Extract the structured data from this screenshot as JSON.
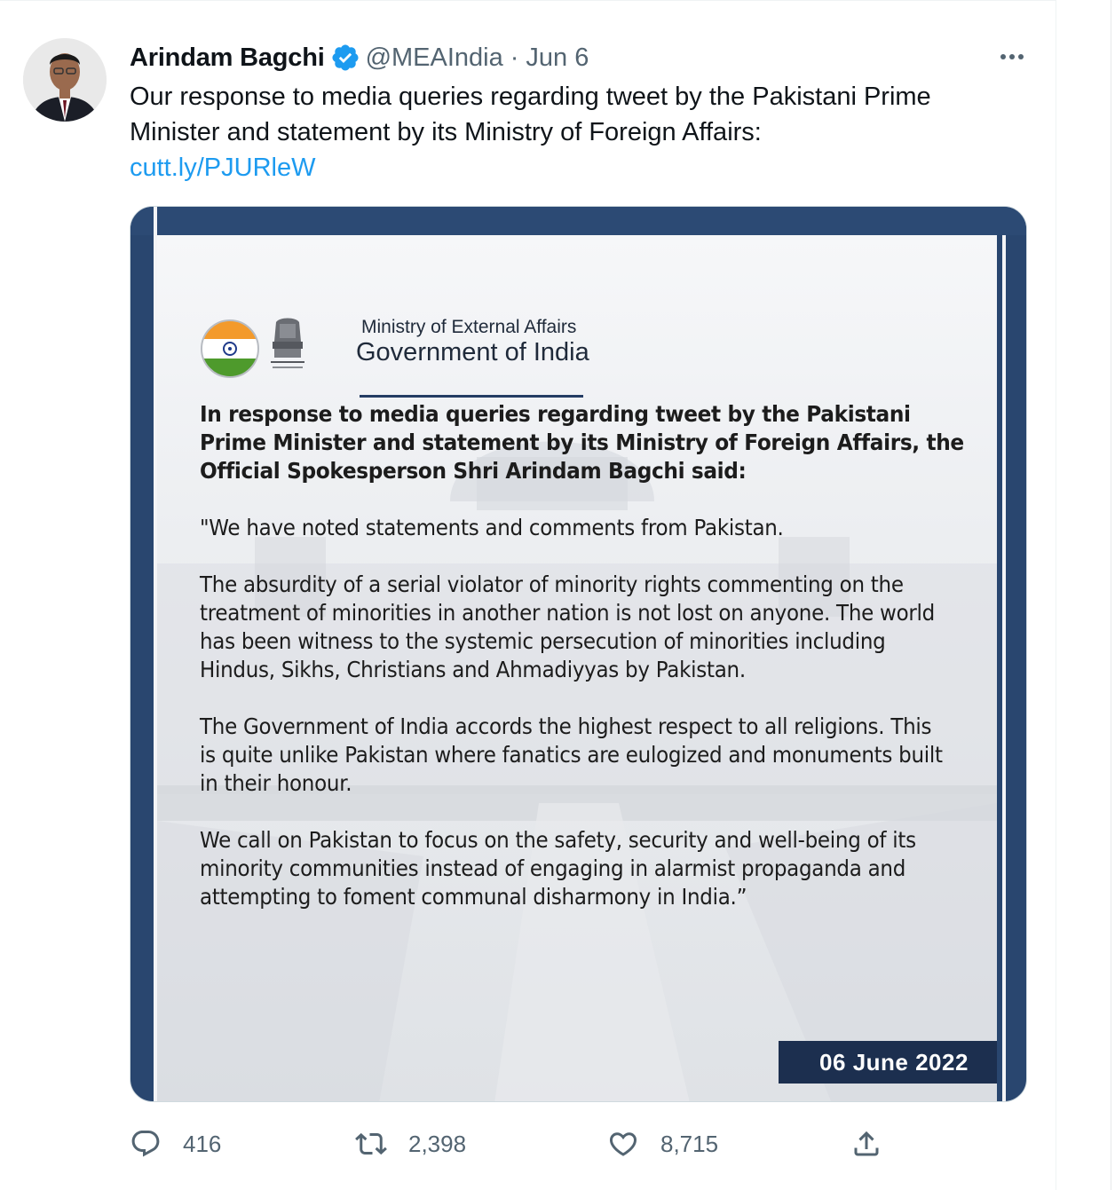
{
  "tweet": {
    "author_name": "Arindam Bagchi",
    "handle": "@MEAIndia",
    "separator": "·",
    "date": "Jun 6",
    "text": "Our response to media queries regarding tweet by the Pakistani Prime Minister and statement by its Ministry of Foreign Affairs:",
    "link": "cutt.ly/PJURleW"
  },
  "media": {
    "org_line1": "Ministry of External Affairs",
    "org_line2": "Government of India",
    "lead": "In response to media queries regarding tweet by the Pakistani Prime Minister and statement by its Ministry of Foreign Affairs, the Official Spokesperson Shri Arindam Bagchi said:",
    "para1": "\"We have noted statements and comments from Pakistan.",
    "para2": "The absurdity of a serial violator of minority rights commenting on the\ntreatment of minorities in another nation is not lost on anyone. The world\nhas been witness to the systemic persecution of minorities including\nHindus, Sikhs, Christians and Ahmadiyyas by Pakistan.",
    "para3": "The Government of India accords the highest respect to all religions. This\nis quite unlike Pakistan where fanatics are eulogized and monuments built\nin their honour.",
    "para4": "We call on Pakistan to focus on the safety, security and well-being of its\nminority communities instead of engaging in alarmist propaganda and\nattempting to foment communal disharmony in India.”",
    "date_badge": "06 June 2022"
  },
  "actions": {
    "replies": "416",
    "retweets": "2,398",
    "likes": "8,715"
  },
  "colors": {
    "accent": "#1d9bf0",
    "frame_navy": "#2c4a74",
    "badge_navy": "#1c2f4f",
    "muted": "#536471"
  },
  "icons": [
    "verified-icon",
    "more-icon",
    "reply-icon",
    "retweet-icon",
    "like-icon",
    "share-icon"
  ]
}
